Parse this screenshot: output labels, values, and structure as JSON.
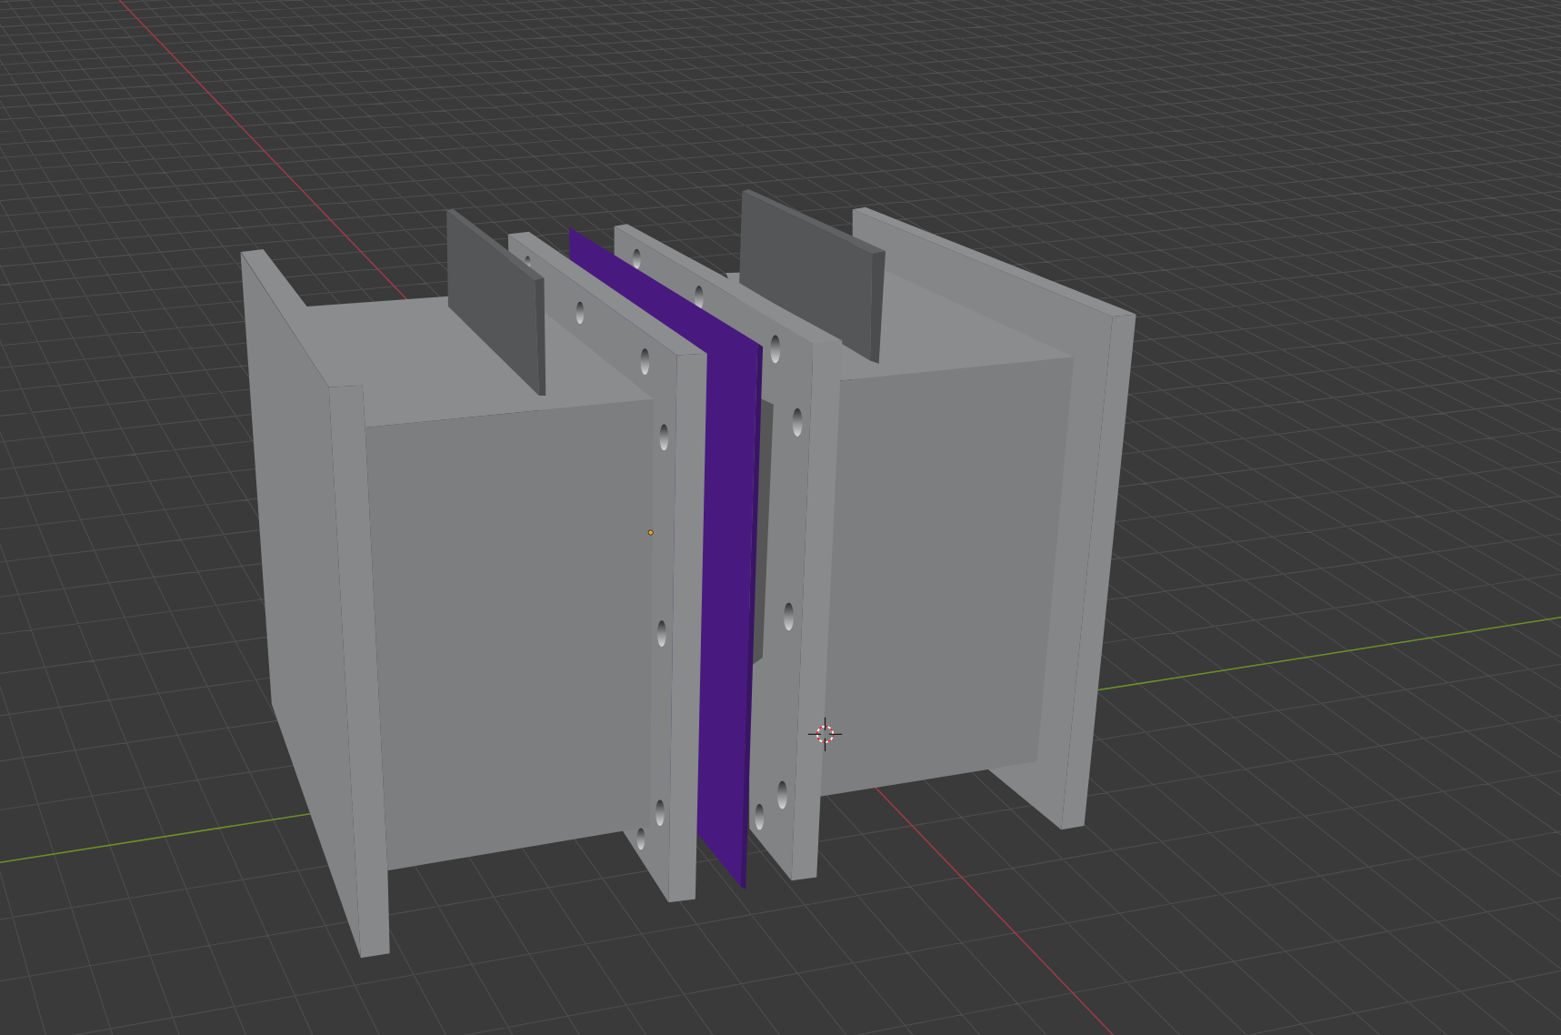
{
  "viewport": {
    "axes": [
      {
        "kind": "x",
        "color": "#9c3a47"
      },
      {
        "kind": "y",
        "color": "#6b8f26"
      }
    ],
    "objects": [
      {
        "kind": "housing",
        "color": "#7d7e7f"
      },
      {
        "kind": "electrode",
        "color": "#545657"
      },
      {
        "kind": "frame",
        "color": "#828384"
      },
      {
        "kind": "membrane",
        "color": "#481a80"
      },
      {
        "kind": "frame",
        "color": "#828384"
      },
      {
        "kind": "electrode",
        "color": "#545657"
      },
      {
        "kind": "housing",
        "color": "#7d7e7f"
      }
    ]
  }
}
